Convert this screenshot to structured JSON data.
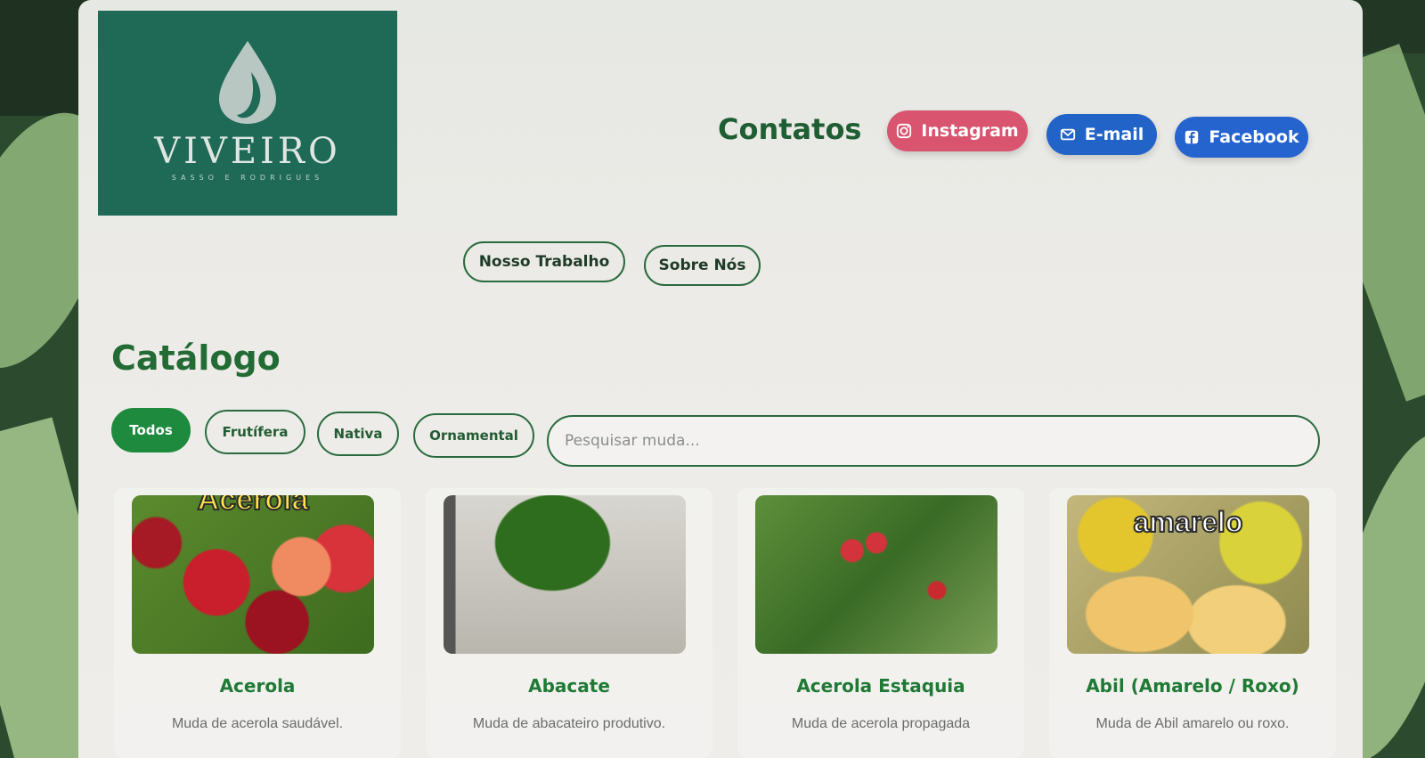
{
  "logo": {
    "name": "VIVEIRO",
    "subtitle": "SASSO E RODRIGUES"
  },
  "contacts": {
    "title": "Contatos",
    "instagram": "Instagram",
    "email": "E-mail",
    "facebook": "Facebook",
    "colors": {
      "instagram": "#d8546f",
      "email": "#2263c8",
      "facebook": "#2563cf"
    }
  },
  "nav": {
    "work": "Nosso Trabalho",
    "about": "Sobre Nós"
  },
  "catalog": {
    "title": "Catálogo",
    "filters": [
      "Todos",
      "Frutífera",
      "Nativa",
      "Ornamental"
    ],
    "active_filter": "Todos",
    "search_placeholder": "Pesquisar muda...",
    "items": [
      {
        "name": "Acerola",
        "description": "Muda de acerola saudável.",
        "image_caption": "Acerola"
      },
      {
        "name": "Abacate",
        "description": "Muda de abacateiro produtivo.",
        "image_caption": ""
      },
      {
        "name": "Acerola Estaquia",
        "description": "Muda de acerola propagada",
        "image_caption": ""
      },
      {
        "name": "Abil (Amarelo / Roxo)",
        "description": "Muda de Abil amarelo ou roxo.",
        "image_caption": "amarelo"
      }
    ]
  },
  "colors": {
    "accent": "#1e8a3e",
    "title_green": "#226b34",
    "logo_bg": "#1f6a56"
  }
}
